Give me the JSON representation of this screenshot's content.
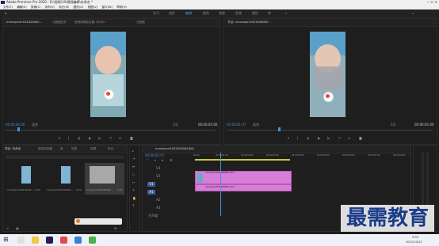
{
  "app": {
    "title": "Adobe Premiere Pro 2020 - D:\\视频\\10\\视频编辑\\未命名 *"
  },
  "menu": [
    "文件(F)",
    "编辑(E)",
    "剪辑(C)",
    "序列(S)",
    "标记(M)",
    "图形(G)",
    "视图(V)",
    "窗口(W)",
    "帮助(H)"
  ],
  "workspaces": [
    "学习",
    "组件",
    "编辑",
    "颜色",
    "效果",
    "音频",
    "图形",
    "库"
  ],
  "source_panel": {
    "tabs": [
      "mmexport1631826082...",
      "元数据控件",
      "音频剪辑混合器: 序列01",
      "元数据"
    ],
    "timecode_in": "00;00;00;00",
    "fit_label": "适合",
    "ratio": "1/2",
    "timecode_out": "00;00;05;00"
  },
  "program_panel": {
    "tab": "节目: mmexport1631826082...",
    "timecode_in": "00:00:01:07",
    "fit_label": "适合",
    "ratio": "1/2",
    "timecode_out": "00:00:05:00"
  },
  "project_panel": {
    "tabs": [
      "项目: 未命名",
      "媒体浏览器",
      "库",
      "信息",
      "效果",
      "标记"
    ],
    "items": [
      {
        "name": "mmexport16318260...",
        "duration": "5:00"
      },
      {
        "name": "mmexport16318260...",
        "duration": "5:00"
      },
      {
        "name": "mmexport16318260...",
        "duration": "5:00"
      }
    ]
  },
  "timeline": {
    "tab": "mmexport1631826082(86)",
    "timecode": "00:00:01:07",
    "ruler": [
      "00:00",
      "00:00:01:00",
      "00:00:02:00",
      "00:00:03:00",
      "00:00:04:00",
      "00:00:05:00",
      "00:00:06:00",
      "00:00:07:00",
      "00:00:08:00"
    ],
    "tracks": [
      "V3",
      "V2",
      "V1",
      "A1",
      "A2",
      "A3",
      "主声道"
    ],
    "video_clip": "mmexport1631826082.mp4",
    "audio_clip": "mmexport1631826082.mp4"
  },
  "taskbar": {
    "time": "9:40",
    "date": "2021/10/22"
  },
  "watermark": {
    "text": "最需教育"
  },
  "colors": {
    "accent": "#4a8fe0",
    "clip": "#d77ed7",
    "playhead": "#4a8fe0"
  }
}
